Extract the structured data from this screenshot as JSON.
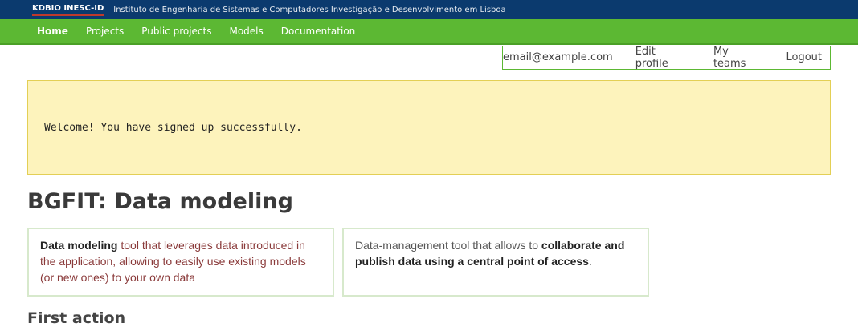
{
  "topbar": {
    "org": "KDBIO INESC-ID",
    "description": "Instituto de Engenharia de Sistemas e Computadores Investigação e Desenvolvimento em Lisboa"
  },
  "nav": {
    "items": [
      "Home",
      "Projects",
      "Public projects",
      "Models",
      "Documentation"
    ]
  },
  "user": {
    "email": "email@example.com",
    "edit_profile": "Edit profile",
    "my_teams": "My teams",
    "logout": "Logout"
  },
  "flash": {
    "message": "Welcome! You have signed up successfully."
  },
  "main": {
    "title": "BGFIT: Data modeling",
    "box1": {
      "bold": "Data modeling",
      "rest": " tool that leverages data introduced in the application, allowing to easily use existing models (or new ones) to your own data"
    },
    "box2": {
      "rest": "Data-management tool that allows to ",
      "bold": "collaborate and publish data using a central point of access",
      "end": "."
    },
    "section_title": "First action"
  },
  "colors": {
    "topbar": "#0b3a6e",
    "navbar": "#5cb833",
    "flash_bg": "#fdf3bc"
  }
}
